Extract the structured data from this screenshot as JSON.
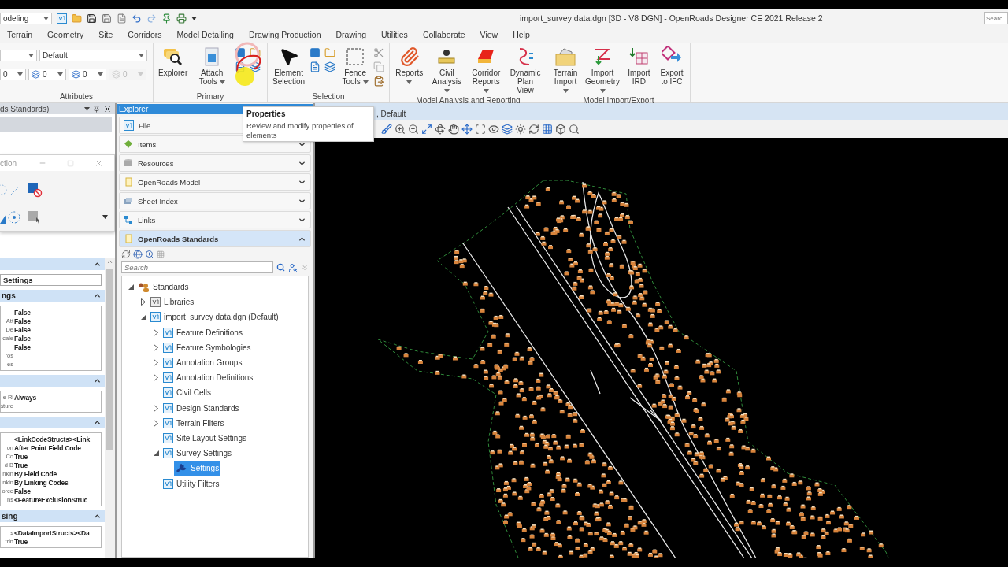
{
  "quick_access": {
    "workflow": "odeling"
  },
  "title": "import_survey data.dgn [3D - V8 DGN] - OpenRoads Designer CE 2021 Release 2",
  "search": {
    "placeholder": "Searc"
  },
  "tabs": [
    {
      "label": "Terrain"
    },
    {
      "label": "Geometry"
    },
    {
      "label": "Site"
    },
    {
      "label": "Corridors"
    },
    {
      "label": "Model Detailing"
    },
    {
      "label": "Drawing Production"
    },
    {
      "label": "Drawing"
    },
    {
      "label": "Utilities"
    },
    {
      "label": "Collaborate"
    },
    {
      "label": "View"
    },
    {
      "label": "Help"
    }
  ],
  "attributes": {
    "label": "Attributes",
    "style": "Default",
    "values": [
      {
        "value": "0",
        "disabled": false
      },
      {
        "value": "0",
        "disabled": false
      },
      {
        "value": "0",
        "disabled": false
      },
      {
        "value": "0",
        "disabled": true
      }
    ]
  },
  "groups": [
    {
      "label": "Primary",
      "buttons": [
        {
          "kind": "large",
          "label": "Explorer",
          "menu": false
        },
        {
          "kind": "large",
          "label": "Attach Tools",
          "menu": true
        },
        {
          "kind": "icon_grid"
        }
      ]
    },
    {
      "label": "Selection",
      "buttons": [
        {
          "kind": "large",
          "label": "Element Selection",
          "menu": false
        },
        {
          "kind": "icon_grid"
        },
        {
          "kind": "large",
          "label": "Fence Tools",
          "menu": true
        },
        {
          "kind": "edit_icons"
        }
      ]
    },
    {
      "label": "Model Analysis and Reporting",
      "buttons": [
        {
          "kind": "large",
          "label": "Reports",
          "menu": true
        },
        {
          "kind": "large",
          "label": "Civil Analysis",
          "menu": true
        },
        {
          "kind": "large",
          "label": "Corridor Reports",
          "menu": true
        },
        {
          "kind": "large",
          "label": "Dynamic Plan View",
          "menu": false
        }
      ]
    },
    {
      "label": "Model Import/Export",
      "buttons": [
        {
          "kind": "large",
          "label": "Terrain Import",
          "menu": true
        },
        {
          "kind": "large",
          "label": "Import Geometry",
          "menu": true
        },
        {
          "kind": "large",
          "label": "Import IRD",
          "menu": false
        },
        {
          "kind": "large",
          "label": "Export to IFC",
          "menu": false
        }
      ]
    }
  ],
  "tooltip": {
    "title": "Properties",
    "text": "Review and modify properties of elements"
  },
  "properties_panel": {
    "title": "ds Standards)",
    "toolbox_title": "ction",
    "sections": [
      {
        "field": "Settings"
      },
      {
        "title": "ngs",
        "rows": [
          {
            "value": "False"
          },
          {
            "label": "Att",
            "value": "False"
          },
          {
            "label": "De",
            "value": "False"
          },
          {
            "label": "cale",
            "value": "False"
          },
          {
            "value": "False"
          },
          {
            "label": "ros"
          },
          {
            "label": "es"
          }
        ]
      },
      {
        "rows": [
          {
            "label": "e Ri",
            "value": "Always"
          },
          {
            "label": "ature"
          }
        ]
      },
      {
        "rows": [
          {
            "value": "<LinkCodeStructs><Link"
          },
          {
            "label": "on",
            "value": "After Point Field Code"
          },
          {
            "label": "Co",
            "value": "True"
          },
          {
            "label": "d B",
            "value": "True"
          },
          {
            "label": "nkin",
            "value": "By Field Code"
          },
          {
            "label": "nkin",
            "value": "By Linking Codes"
          },
          {
            "label": "orce",
            "value": "False"
          },
          {
            "label": "ns",
            "value": "<FeatureExclusionStruc"
          }
        ]
      },
      {
        "title": "sing",
        "rows": [
          {
            "label": "s",
            "value": "<DataImportStructs><Da"
          },
          {
            "label": "trin",
            "value": "True"
          }
        ]
      }
    ]
  },
  "explorer": {
    "title": "Explorer",
    "sections": [
      {
        "kind": "file",
        "label": "File",
        "expanded": false
      },
      {
        "kind": "items",
        "label": "Items",
        "expanded": false
      },
      {
        "kind": "resources",
        "label": "Resources",
        "expanded": false
      },
      {
        "kind": "model",
        "label": "OpenRoads Model",
        "expanded": false
      },
      {
        "kind": "sheet",
        "label": "Sheet Index",
        "expanded": false
      },
      {
        "kind": "links",
        "label": "Links",
        "expanded": false
      },
      {
        "kind": "standards",
        "label": "OpenRoads Standards",
        "expanded": true
      }
    ],
    "search": {
      "placeholder": "Search"
    },
    "tree": [
      {
        "kind": "standards",
        "label": "Standards",
        "expanded": true,
        "selected": false,
        "children": [
          {
            "kind": "library",
            "label": "Libraries",
            "expanded": false,
            "selected": false
          },
          {
            "kind": "dgn",
            "label": "import_survey data.dgn (Default)",
            "expanded": true,
            "selected": false,
            "children": [
              {
                "kind": "dgn",
                "label": "Feature Definitions",
                "expanded": false,
                "selected": false
              },
              {
                "kind": "dgn",
                "label": "Feature Symbologies",
                "expanded": false,
                "selected": false
              },
              {
                "kind": "dgn",
                "label": "Annotation Groups",
                "expanded": false,
                "selected": false
              },
              {
                "kind": "dgn",
                "label": "Annotation Definitions",
                "expanded": false,
                "selected": false
              },
              {
                "kind": "dgn",
                "label": "Civil Cells",
                "selected": false
              },
              {
                "kind": "dgn",
                "label": "Design Standards",
                "expanded": false,
                "selected": false
              },
              {
                "kind": "dgn",
                "label": "Terrain Filters",
                "expanded": false,
                "selected": false
              },
              {
                "kind": "dgn",
                "label": "Site Layout Settings",
                "selected": false
              },
              {
                "kind": "dgn",
                "label": "Survey Settings",
                "expanded": true,
                "selected": false,
                "children": [
                  {
                    "kind": "settings",
                    "label": "Settings",
                    "selected": true
                  }
                ]
              },
              {
                "kind": "dgn",
                "label": "Utility Filters",
                "selected": false
              }
            ]
          }
        ]
      }
    ]
  },
  "view": {
    "title": ", Default"
  }
}
